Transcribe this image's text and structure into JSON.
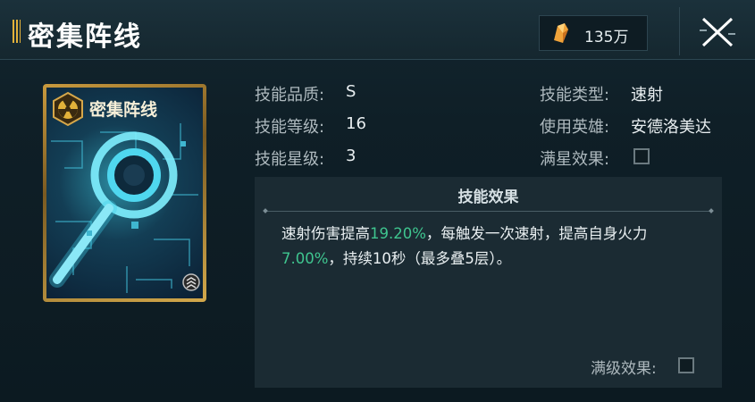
{
  "header": {
    "title": "密集阵线",
    "currency_amount": "135万",
    "currency_icon": "crystal-icon",
    "close_icon": "close-icon"
  },
  "card": {
    "name": "密集阵线",
    "emblem_icon": "radiation-emblem-icon",
    "art_icon": "circuit-target-icon"
  },
  "info": {
    "quality_label": "技能品质:",
    "quality_value": "S",
    "level_label": "技能等级:",
    "level_value": "16",
    "star_label": "技能星级:",
    "star_value": "3",
    "type_label": "技能类型:",
    "type_value": "速射",
    "hero_label": "使用英雄:",
    "hero_value": "安德洛美达",
    "maxstar_label": "满星效果:",
    "maxstar_checked": false
  },
  "effect": {
    "title": "技能效果",
    "seg1": "速射伤害提高",
    "hl1": "19.20%",
    "seg2": "，每触发一次速射，提高自身火力",
    "hl2": "7.00%",
    "seg3": "，持续10秒（最多叠5层）。",
    "maxlevel_label": "满级效果:",
    "maxlevel_checked": false
  },
  "colors": {
    "accent_gold": "#e2b13a",
    "highlight_green": "#3fc58f",
    "panel_bg": "#0d1b22"
  }
}
